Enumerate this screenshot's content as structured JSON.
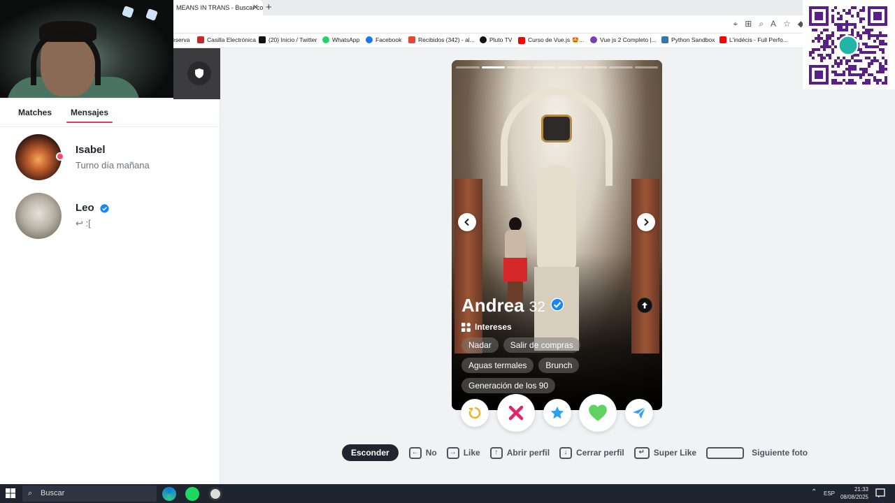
{
  "browser": {
    "tab_title": "MEANS IN TRANS - Buscar co",
    "new_tab_symbol": "+",
    "close_symbol": "✕"
  },
  "bookmarks": [
    {
      "label": "eserva",
      "icon": "bookmark-icon",
      "color": "#888888"
    },
    {
      "label": "Casilla Electrónica",
      "icon": "casilla-icon",
      "color": "#c62828"
    },
    {
      "label": "(20) Inicio / Twitter",
      "icon": "x-icon",
      "color": "#111111"
    },
    {
      "label": "WhatsApp",
      "icon": "whatsapp-icon",
      "color": "#25d366"
    },
    {
      "label": "Facebook",
      "icon": "facebook-icon",
      "color": "#1877f2"
    },
    {
      "label": "Recibidos (342) - al...",
      "icon": "gmail-icon",
      "color": "#ea4335"
    },
    {
      "label": "Pluto TV",
      "icon": "pluto-icon",
      "color": "#111111"
    },
    {
      "label": "Curso de Vue.js 🤩...",
      "icon": "youtube-icon",
      "color": "#ff0000"
    },
    {
      "label": "Vue js 2 Completo |...",
      "icon": "vue-icon",
      "color": "#7b3fb5"
    },
    {
      "label": "Python Sandbox",
      "icon": "python-icon",
      "color": "#3776ab"
    },
    {
      "label": "L'indécis - Full Perfo...",
      "icon": "youtube-icon",
      "color": "#ff0000"
    }
  ],
  "sidebar": {
    "tabs": [
      {
        "label": "Matches"
      },
      {
        "label": "Mensajes"
      }
    ],
    "messages": [
      {
        "name": "Isabel",
        "preview": "Turno día mañana",
        "online": true
      },
      {
        "name": "Leo",
        "preview": "↩ :[",
        "verified": true
      }
    ]
  },
  "profile": {
    "name": "Andrea",
    "age": "32",
    "verified": true,
    "interests_title": "Intereses",
    "interests": [
      "Nadar",
      "Salir de compras",
      "Aguas termales",
      "Brunch",
      "Generación de los 90"
    ],
    "photo_count": 8,
    "active_photo": 2
  },
  "actions": [
    {
      "name": "rewind",
      "icon": "rewind-icon",
      "color": "#f0b429"
    },
    {
      "name": "nope",
      "icon": "close-x-icon",
      "color": "#e2246e"
    },
    {
      "name": "superlike",
      "icon": "star-icon",
      "color": "#2a9df4"
    },
    {
      "name": "like",
      "icon": "heart-icon",
      "color": "#5fd25f"
    },
    {
      "name": "boost",
      "icon": "send-icon",
      "color": "#31a4f2"
    }
  ],
  "shortcuts": {
    "hide_label": "Esconder",
    "items": [
      {
        "label": "No",
        "key": "←"
      },
      {
        "label": "Like",
        "key": "→"
      },
      {
        "label": "Abrir perfil",
        "key": "↑"
      },
      {
        "label": "Cerrar perfil",
        "key": "↓"
      },
      {
        "label": "Super Like",
        "key": "↵"
      },
      {
        "label": "Siguiente foto",
        "key": ""
      }
    ]
  },
  "taskbar": {
    "search_placeholder": "Buscar",
    "language": "ESP",
    "time": "21:33",
    "date": "08/08/2025"
  },
  "colors": {
    "accent": "#e2375f",
    "verified": "#1786f8"
  }
}
